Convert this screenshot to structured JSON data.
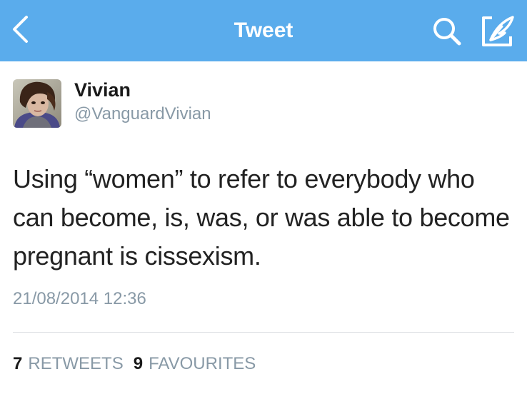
{
  "navbar": {
    "title": "Tweet",
    "background": "#5aacec",
    "back_icon": "chevron-left-icon",
    "search_icon": "search-icon",
    "compose_icon": "compose-icon"
  },
  "author": {
    "name": "Vivian",
    "handle": "@VanguardVivian"
  },
  "tweet": {
    "text": "Using “women” to refer to everybody who can become, is, was, or was able to become pregnant is cissexism.",
    "timestamp": "21/08/2014 12:36"
  },
  "stats": {
    "retweets_count": "7",
    "retweets_label": "RETWEETS",
    "favourites_count": "9",
    "favourites_label": "FAVOURITES"
  }
}
